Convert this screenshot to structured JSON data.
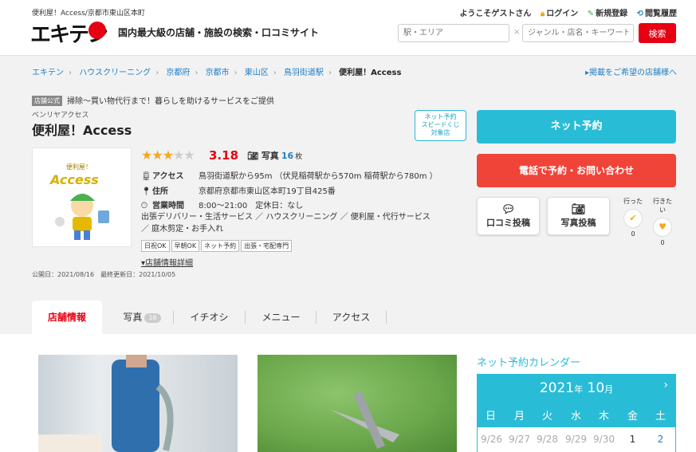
{
  "header": {
    "site_sub": "便利屋！Access/京都市東山区本町",
    "logo_text": "エキテン",
    "tagline": "国内最大級の店舗・施設の検索・口コミサイト",
    "welcome": "ようこそゲストさん",
    "login": "ログイン",
    "register": "新規登録",
    "history": "閲覧履歴",
    "area_placeholder": "駅・エリア",
    "keyword_placeholder": "ジャンル・店名・キーワード",
    "search_label": "検索"
  },
  "breadcrumb": {
    "items": [
      "エキテン",
      "ハウスクリーニング",
      "京都府",
      "京都市",
      "東山区",
      "鳥羽街道駅"
    ],
    "current": "便利屋！Access",
    "right_link": "掲載をご希望の店舗様へ"
  },
  "shop": {
    "official_badge": "店舗公式",
    "catch": "掃除～買い物代行まで！暮らしを助けるサービスをご提供",
    "kana": "ベンリヤアクセス",
    "name": "便利屋！Access",
    "speed_badge": [
      "ネット予約",
      "スピードくじ",
      "対象店"
    ],
    "photo_caption": "便利屋！",
    "photo_word": "Access",
    "rating": 3.18,
    "rating_text": "3.18",
    "photos_label": "写真",
    "photos_count": "16",
    "photos_unit": "枚",
    "access_label": "アクセス",
    "access": "鳥羽街道駅から95m （伏見稲荷駅から570m 稲荷駅から780m ）",
    "address_label": "住所",
    "address": "京都府京都市東山区本町19丁目425番",
    "hours_label": "営業時間",
    "hours": "8:00～21:00　定休日：なし",
    "categories": "出張デリバリー・生活サービス ／ ハウスクリーニング ／ 便利屋・代行サービス ／ 庭木剪定・お手入れ",
    "tags": [
      "日祝OK",
      "早朝OK",
      "ネット予約",
      "出張・宅配専門"
    ],
    "detail_link": "▾店舗情報詳細",
    "dates": "公開日：2021/08/16　最終更新日：2021/10/05"
  },
  "actions": {
    "net_reserve": "ネット予約",
    "tel_reserve": "電話で予約・お問い合わせ",
    "review": "口コミ投稿",
    "photo_post": "写真投稿",
    "went_label": "行った",
    "went_count": "0",
    "want_label": "行きたい",
    "want_count": "0"
  },
  "tabs": [
    {
      "label": "店舗情報"
    },
    {
      "label": "写真",
      "count": "16"
    },
    {
      "label": "イチオシ"
    },
    {
      "label": "メニュー"
    },
    {
      "label": "アクセス"
    }
  ],
  "calendar": {
    "title": "ネット予約カレンダー",
    "year": "2021",
    "year_unit": "年",
    "month": "10",
    "month_unit": "月",
    "next": "›",
    "weekdays": [
      "日",
      "月",
      "火",
      "水",
      "木",
      "金",
      "土"
    ],
    "first_row": [
      "9/26",
      "9/27",
      "9/28",
      "9/29",
      "9/30",
      "1",
      "2"
    ]
  },
  "colors": {
    "brand_red": "#e60012",
    "accent_cyan": "#29bcd6",
    "link_blue": "#1e7ec8",
    "star": "#f5a623"
  }
}
